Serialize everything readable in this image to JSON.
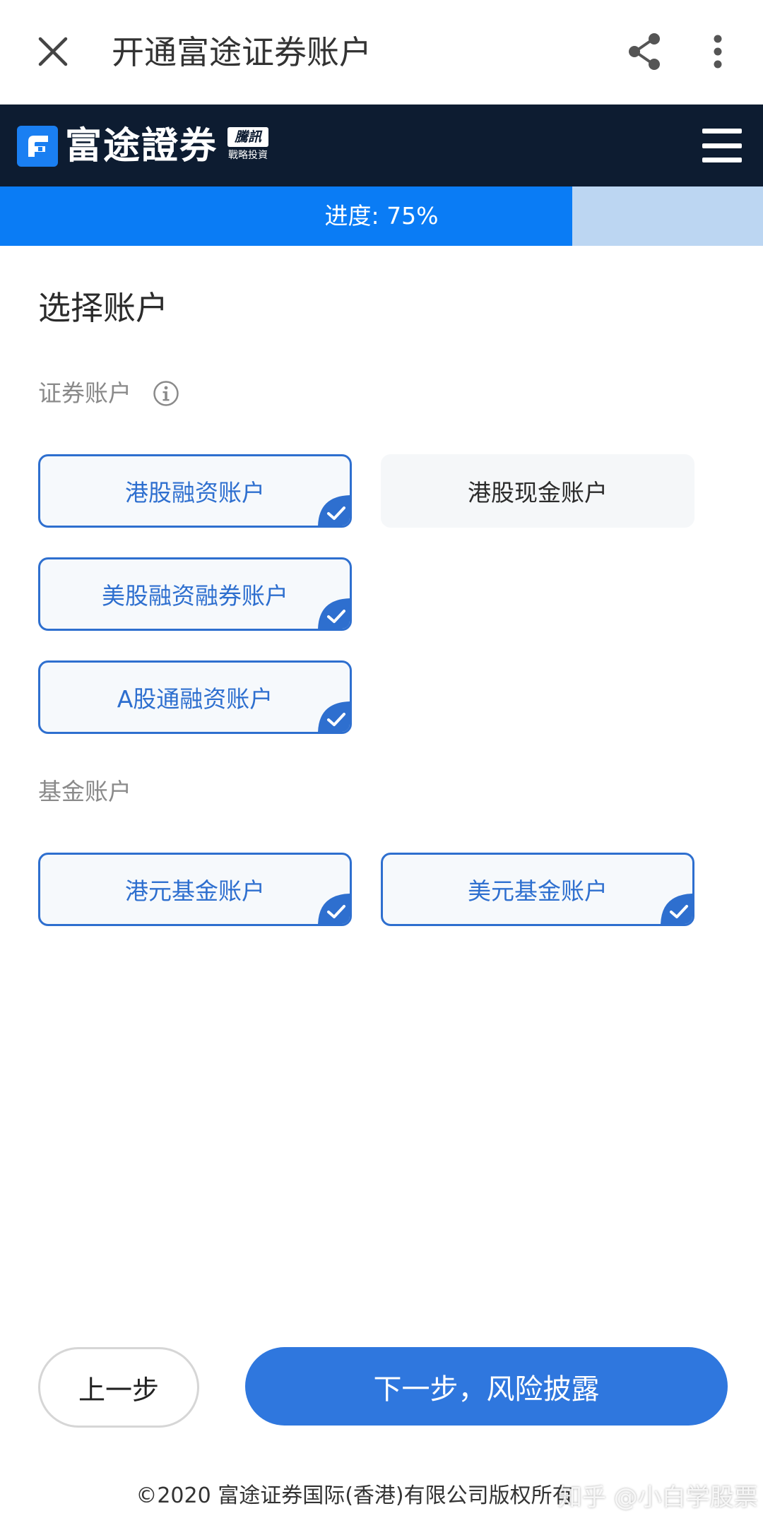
{
  "appbar": {
    "title": "开通富途证券账户",
    "close_icon": "close-icon",
    "share_icon": "share-icon",
    "more_icon": "more-vertical-icon"
  },
  "brand": {
    "name": "富途證券",
    "badge_top": "騰訊",
    "badge_bottom": "戰略投資",
    "menu_icon": "hamburger-menu-icon"
  },
  "progress": {
    "label": "进度: 75%",
    "value": 0.75
  },
  "main": {
    "title": "选择账户",
    "securities_group": {
      "label": "证券账户",
      "info_icon": "info-icon",
      "options": [
        {
          "label": "港股融资账户",
          "selected": true
        },
        {
          "label": "港股现金账户",
          "selected": false
        },
        {
          "label": "美股融资融券账户",
          "selected": true
        },
        {
          "label": "A股通融资账户",
          "selected": true
        }
      ]
    },
    "fund_group": {
      "label": "基金账户",
      "options": [
        {
          "label": "港元基金账户",
          "selected": true
        },
        {
          "label": "美元基金账户",
          "selected": true
        }
      ]
    }
  },
  "actions": {
    "prev_label": "上一步",
    "next_label": "下一步，风险披露"
  },
  "footer": {
    "copyright": "©2020 富途证券国际(香港)有限公司版权所有"
  },
  "watermark": "知乎 @小白学股票",
  "colors": {
    "accent": "#2f77de",
    "progress_fill": "#0a7cf5",
    "progress_track": "#bcd6f2",
    "brand_bar": "#0d1c31"
  }
}
